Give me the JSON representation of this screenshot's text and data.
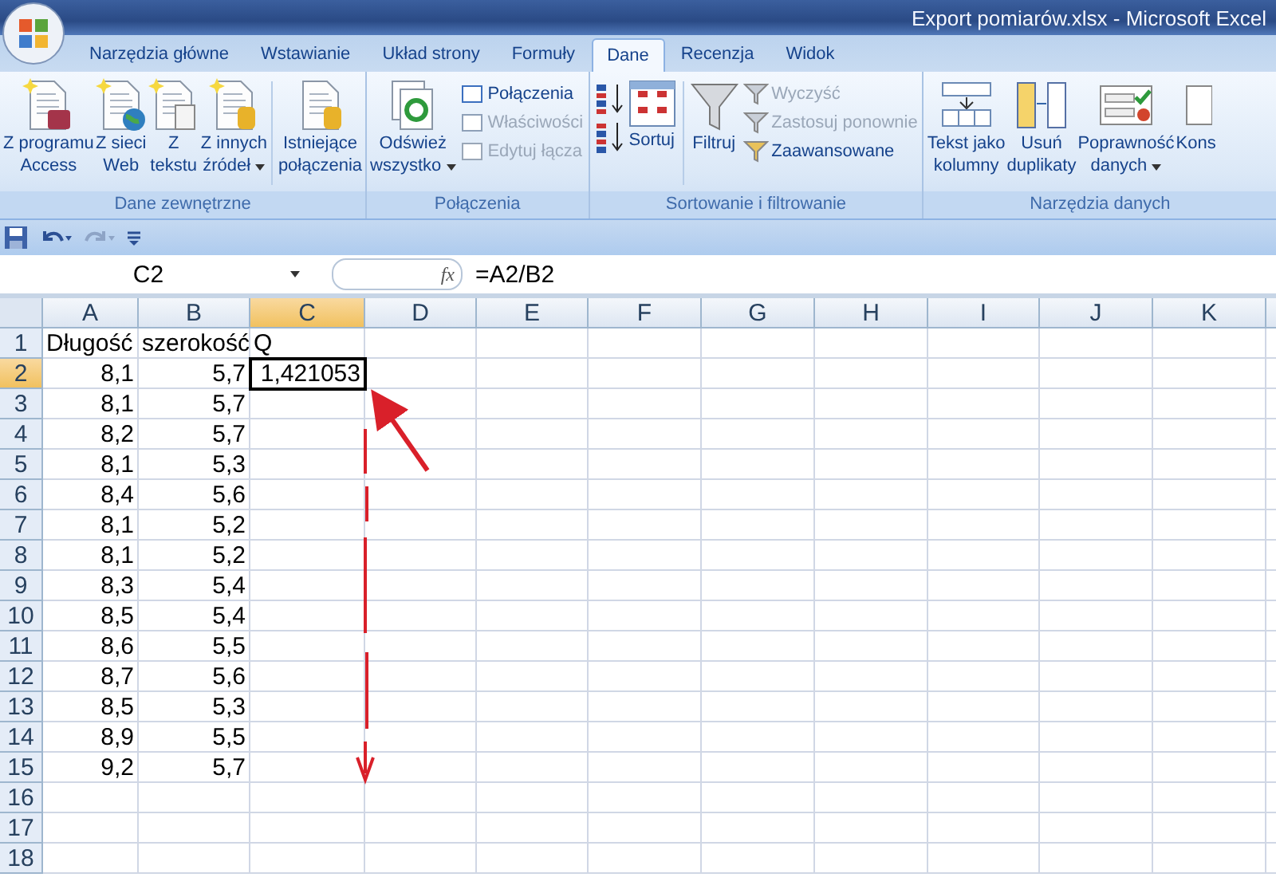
{
  "window": {
    "title": "Export pomiarów.xlsx - Microsoft Excel"
  },
  "tabs": [
    {
      "label": "Narzędzia główne",
      "selected": false
    },
    {
      "label": "Wstawianie",
      "selected": false
    },
    {
      "label": "Układ strony",
      "selected": false
    },
    {
      "label": "Formuły",
      "selected": false
    },
    {
      "label": "Dane",
      "selected": true
    },
    {
      "label": "Recenzja",
      "selected": false
    },
    {
      "label": "Widok",
      "selected": false
    }
  ],
  "ribbon": [
    {
      "title": "Dane zewnętrzne",
      "items": [
        {
          "kind": "large",
          "lines": [
            "Z programu",
            "Access"
          ],
          "dropdown": false
        },
        {
          "kind": "large",
          "lines": [
            "Z sieci",
            "Web"
          ],
          "dropdown": false
        },
        {
          "kind": "large",
          "lines": [
            "Z",
            "tekstu"
          ],
          "dropdown": false
        },
        {
          "kind": "large",
          "lines": [
            "Z innych",
            "źródeł"
          ],
          "dropdown": true
        },
        {
          "kind": "separator"
        },
        {
          "kind": "large",
          "lines": [
            "Istniejące",
            "połączenia"
          ],
          "dropdown": false
        }
      ]
    },
    {
      "title": "Połączenia",
      "items": [
        {
          "kind": "large",
          "lines": [
            "Odśwież",
            "wszystko"
          ],
          "dropdown": true
        },
        {
          "kind": "stack",
          "buttons": [
            {
              "label": "Połączenia",
              "disabled": false
            },
            {
              "label": "Właściwości",
              "disabled": true
            },
            {
              "label": "Edytuj łącza",
              "disabled": true
            }
          ]
        }
      ]
    },
    {
      "title": "Sortowanie i filtrowanie",
      "items": [
        {
          "kind": "iconstack"
        },
        {
          "kind": "large",
          "lines": [
            "Sortuj"
          ],
          "dropdown": false
        },
        {
          "kind": "separator"
        },
        {
          "kind": "large",
          "lines": [
            "Filtruj"
          ],
          "dropdown": false
        },
        {
          "kind": "stack",
          "buttons": [
            {
              "label": "Wyczyść",
              "disabled": true
            },
            {
              "label": "Zastosuj ponownie",
              "disabled": true
            },
            {
              "label": "Zaawansowane",
              "disabled": false
            }
          ]
        }
      ]
    },
    {
      "title": "Narzędzia danych",
      "items": [
        {
          "kind": "large",
          "lines": [
            "Tekst jako",
            "kolumny"
          ],
          "dropdown": false
        },
        {
          "kind": "large",
          "lines": [
            "Usuń",
            "duplikaty"
          ],
          "dropdown": false
        },
        {
          "kind": "large",
          "lines": [
            "Poprawność",
            "danych"
          ],
          "dropdown": true
        },
        {
          "kind": "large",
          "lines": [
            "Kons"
          ],
          "dropdown": false
        }
      ]
    }
  ],
  "name_box": "C2",
  "function_label": "fx",
  "formula": "=A2/B2",
  "columns": [
    {
      "label": "A",
      "selected": false
    },
    {
      "label": "B",
      "selected": false
    },
    {
      "label": "C",
      "selected": true
    },
    {
      "label": "D",
      "selected": false
    },
    {
      "label": "E",
      "selected": false
    },
    {
      "label": "F",
      "selected": false
    },
    {
      "label": "G",
      "selected": false
    },
    {
      "label": "H",
      "selected": false
    },
    {
      "label": "I",
      "selected": false
    },
    {
      "label": "J",
      "selected": false
    },
    {
      "label": "K",
      "selected": false
    }
  ],
  "rows": [
    {
      "number": "1",
      "selected": false,
      "cells": [
        "Długość",
        "szerokość",
        "Q"
      ]
    },
    {
      "number": "2",
      "selected": true,
      "cells": [
        "8,1",
        "5,7",
        "1,421053"
      ]
    },
    {
      "number": "3",
      "selected": false,
      "cells": [
        "8,1",
        "5,7",
        ""
      ]
    },
    {
      "number": "4",
      "selected": false,
      "cells": [
        "8,2",
        "5,7",
        ""
      ]
    },
    {
      "number": "5",
      "selected": false,
      "cells": [
        "8,1",
        "5,3",
        ""
      ]
    },
    {
      "number": "6",
      "selected": false,
      "cells": [
        "8,4",
        "5,6",
        ""
      ]
    },
    {
      "number": "7",
      "selected": false,
      "cells": [
        "8,1",
        "5,2",
        ""
      ]
    },
    {
      "number": "8",
      "selected": false,
      "cells": [
        "8,1",
        "5,2",
        ""
      ]
    },
    {
      "number": "9",
      "selected": false,
      "cells": [
        "8,3",
        "5,4",
        ""
      ]
    },
    {
      "number": "10",
      "selected": false,
      "cells": [
        "8,5",
        "5,4",
        ""
      ]
    },
    {
      "number": "11",
      "selected": false,
      "cells": [
        "8,6",
        "5,5",
        ""
      ]
    },
    {
      "number": "12",
      "selected": false,
      "cells": [
        "8,7",
        "5,6",
        ""
      ]
    },
    {
      "number": "13",
      "selected": false,
      "cells": [
        "8,5",
        "5,3",
        ""
      ]
    },
    {
      "number": "14",
      "selected": false,
      "cells": [
        "8,9",
        "5,5",
        ""
      ]
    },
    {
      "number": "15",
      "selected": false,
      "cells": [
        "9,2",
        "5,7",
        ""
      ]
    },
    {
      "number": "16",
      "selected": false,
      "cells": [
        "",
        "",
        ""
      ]
    },
    {
      "number": "17",
      "selected": false,
      "cells": [
        "",
        "",
        ""
      ]
    },
    {
      "number": "18",
      "selected": false,
      "cells": [
        "",
        "",
        ""
      ]
    }
  ]
}
